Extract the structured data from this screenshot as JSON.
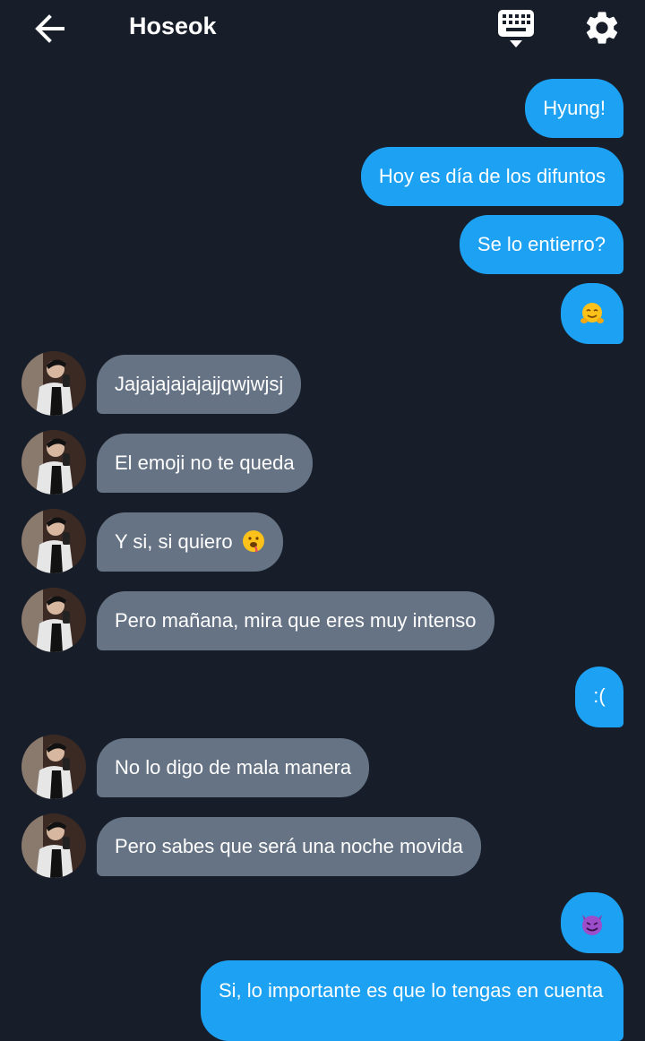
{
  "header": {
    "title": "Hoseok",
    "back_icon": "arrow-left-icon",
    "keyboard_icon": "keyboard-icon",
    "settings_icon": "gear-icon"
  },
  "colors": {
    "background": "#171e29",
    "outgoing_bubble": "#1da1f2",
    "incoming_bubble": "#657384",
    "text": "#ffffff"
  },
  "messages": [
    {
      "sender": "me",
      "text": "Hyung!"
    },
    {
      "sender": "me",
      "text": "Hoy es día de los difuntos"
    },
    {
      "sender": "me",
      "text": "Se lo entierro?"
    },
    {
      "sender": "me",
      "text": "",
      "emoji": "hugging-face-emoji"
    },
    {
      "sender": "Hoseok",
      "text": "Jajajajajajajjqwjwjsj"
    },
    {
      "sender": "Hoseok",
      "text": "El emoji no te queda"
    },
    {
      "sender": "Hoseok",
      "text": "Y si, si quiero",
      "emoji": "drooling-face-emoji"
    },
    {
      "sender": "Hoseok",
      "text": "Pero mañana, mira que eres muy intenso"
    },
    {
      "sender": "me",
      "text": ":("
    },
    {
      "sender": "Hoseok",
      "text": "No lo digo de mala manera"
    },
    {
      "sender": "Hoseok",
      "text": "Pero sabes que será una noche movida"
    },
    {
      "sender": "me",
      "text": "",
      "emoji": "smiling-devil-emoji"
    },
    {
      "sender": "me",
      "text": "Si, lo importante es que lo tengas en cuenta"
    }
  ]
}
